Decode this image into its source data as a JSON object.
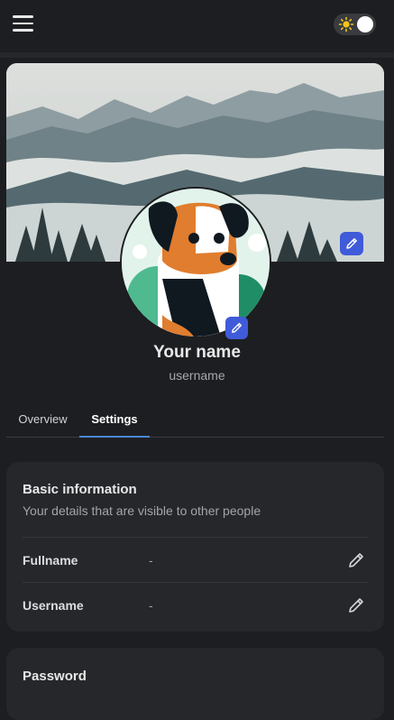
{
  "topbar": {
    "menu_icon": "hamburger-menu-icon",
    "theme_toggle_icon": "sun-icon"
  },
  "profile": {
    "name": "Your name",
    "username": "username",
    "avatar_description_icon": "dog-avatar",
    "cover_edit_icon": "pencil-icon",
    "avatar_edit_icon": "pencil-icon"
  },
  "tabs": [
    {
      "label": "Overview",
      "active": false
    },
    {
      "label": "Settings",
      "active": true
    }
  ],
  "basic_info": {
    "title": "Basic information",
    "subtitle": "Your details that are visible to other people",
    "rows": [
      {
        "label": "Fullname",
        "value": "-"
      },
      {
        "label": "Username",
        "value": "-"
      }
    ]
  },
  "password": {
    "title": "Password"
  },
  "colors": {
    "background": "#1d1e21",
    "card": "#26272b",
    "accent": "#3f5bd9",
    "tab_underline": "#4a86d6"
  }
}
